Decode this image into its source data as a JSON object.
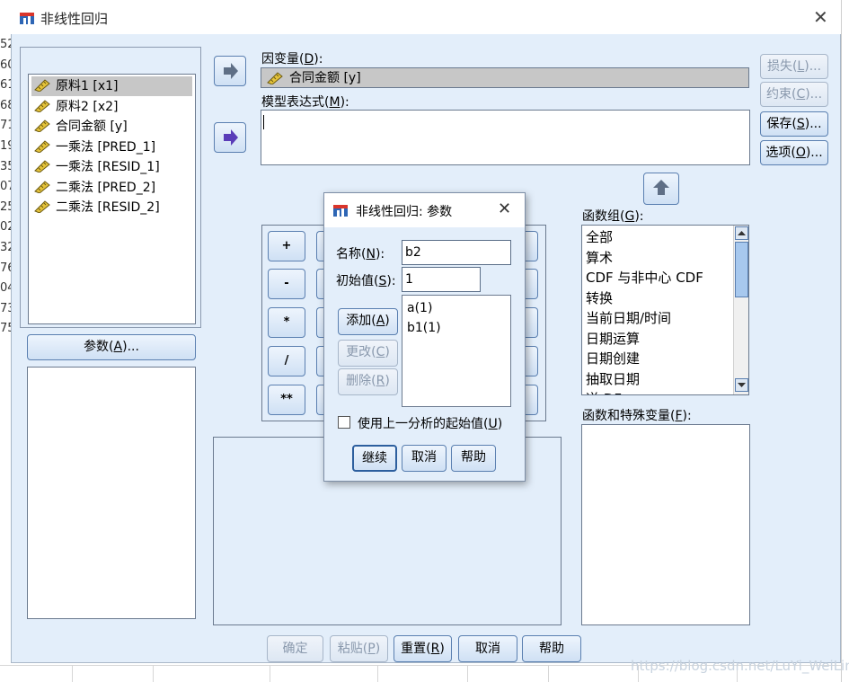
{
  "window": {
    "title": "非线性回归"
  },
  "background_rows": [
    "52",
    "60",
    "61",
    "68",
    "71",
    "19",
    "35",
    "07",
    "25",
    "02",
    "32",
    "76",
    "04",
    "73",
    "75"
  ],
  "variables": [
    {
      "label": "原料1 [x1]",
      "selected": true
    },
    {
      "label": "原料2 [x2]",
      "selected": false
    },
    {
      "label": "合同金额 [y]",
      "selected": false
    },
    {
      "label": "一乘法 [PRED_1]",
      "selected": false
    },
    {
      "label": "一乘法 [RESID_1]",
      "selected": false
    },
    {
      "label": "二乘法 [PRED_2]",
      "selected": false
    },
    {
      "label": "二乘法 [RESID_2]",
      "selected": false
    }
  ],
  "params_button": {
    "text": "参数(",
    "key": "A",
    "suffix": ")..."
  },
  "dependent": {
    "label_text": "因变量(",
    "key": "D",
    "suffix": "):",
    "value": "合同金额 [y]"
  },
  "model_expr": {
    "label_text": "模型表达式(",
    "key": "M",
    "suffix": "):",
    "value": ""
  },
  "side_buttons": [
    {
      "text": "损失(",
      "key": "L",
      "suffix": ")...",
      "enabled": false
    },
    {
      "text": "约束(",
      "key": "C",
      "suffix": ")...",
      "enabled": false
    },
    {
      "text": "保存(",
      "key": "S",
      "suffix": ")...",
      "enabled": true
    },
    {
      "text": "选项(",
      "key": "O",
      "suffix": ")...",
      "enabled": true
    }
  ],
  "calc_buttons": [
    "+",
    "-",
    "*",
    "/",
    "**"
  ],
  "function_group": {
    "label_text": "函数组(",
    "key": "G",
    "suffix": "):",
    "items": [
      "全部",
      "算术",
      "CDF 与非中心 CDF",
      "转换",
      "当前日期/时间",
      "日期运算",
      "日期创建",
      "抽取日期",
      "逆 DF"
    ]
  },
  "functions": {
    "label_text": "函数和特殊变量(",
    "key": "F",
    "suffix": "):"
  },
  "bottom_buttons": [
    {
      "text": "确定",
      "key": "",
      "suffix": "",
      "enabled": false
    },
    {
      "text": "粘贴(",
      "key": "P",
      "suffix": ")",
      "enabled": false
    },
    {
      "text": "重置(",
      "key": "R",
      "suffix": ")",
      "enabled": true
    },
    {
      "text": "取消",
      "key": "",
      "suffix": "",
      "enabled": true
    },
    {
      "text": "帮助",
      "key": "",
      "suffix": "",
      "enabled": true
    }
  ],
  "param_dialog": {
    "title": "非线性回归: 参数",
    "name_label": {
      "text": "名称(",
      "key": "N",
      "suffix": "):"
    },
    "name_value": "b2",
    "start_label": {
      "text": "初始值(",
      "key": "S",
      "suffix": "):"
    },
    "start_value": "1",
    "add": {
      "text": "添加(",
      "key": "A",
      "suffix": ")"
    },
    "change": {
      "text": "更改(",
      "key": "C",
      "suffix": ")"
    },
    "remove": {
      "text": "删除(",
      "key": "R",
      "suffix": ")"
    },
    "params": [
      "a(1)",
      "b1(1)"
    ],
    "checkbox": {
      "text": "使用上一分析的起始值(",
      "key": "U",
      "suffix": ")",
      "checked": false
    },
    "continue": "继续",
    "cancel": "取消",
    "help": "帮助"
  },
  "watermark": "https://blog.csdn.net/LuYi_WeiLin",
  "colors": {
    "accent": "#2d5f9e",
    "panel_bg": "#e3eefa",
    "button_top": "#eef5fd",
    "button_bottom": "#cfe0f4"
  }
}
